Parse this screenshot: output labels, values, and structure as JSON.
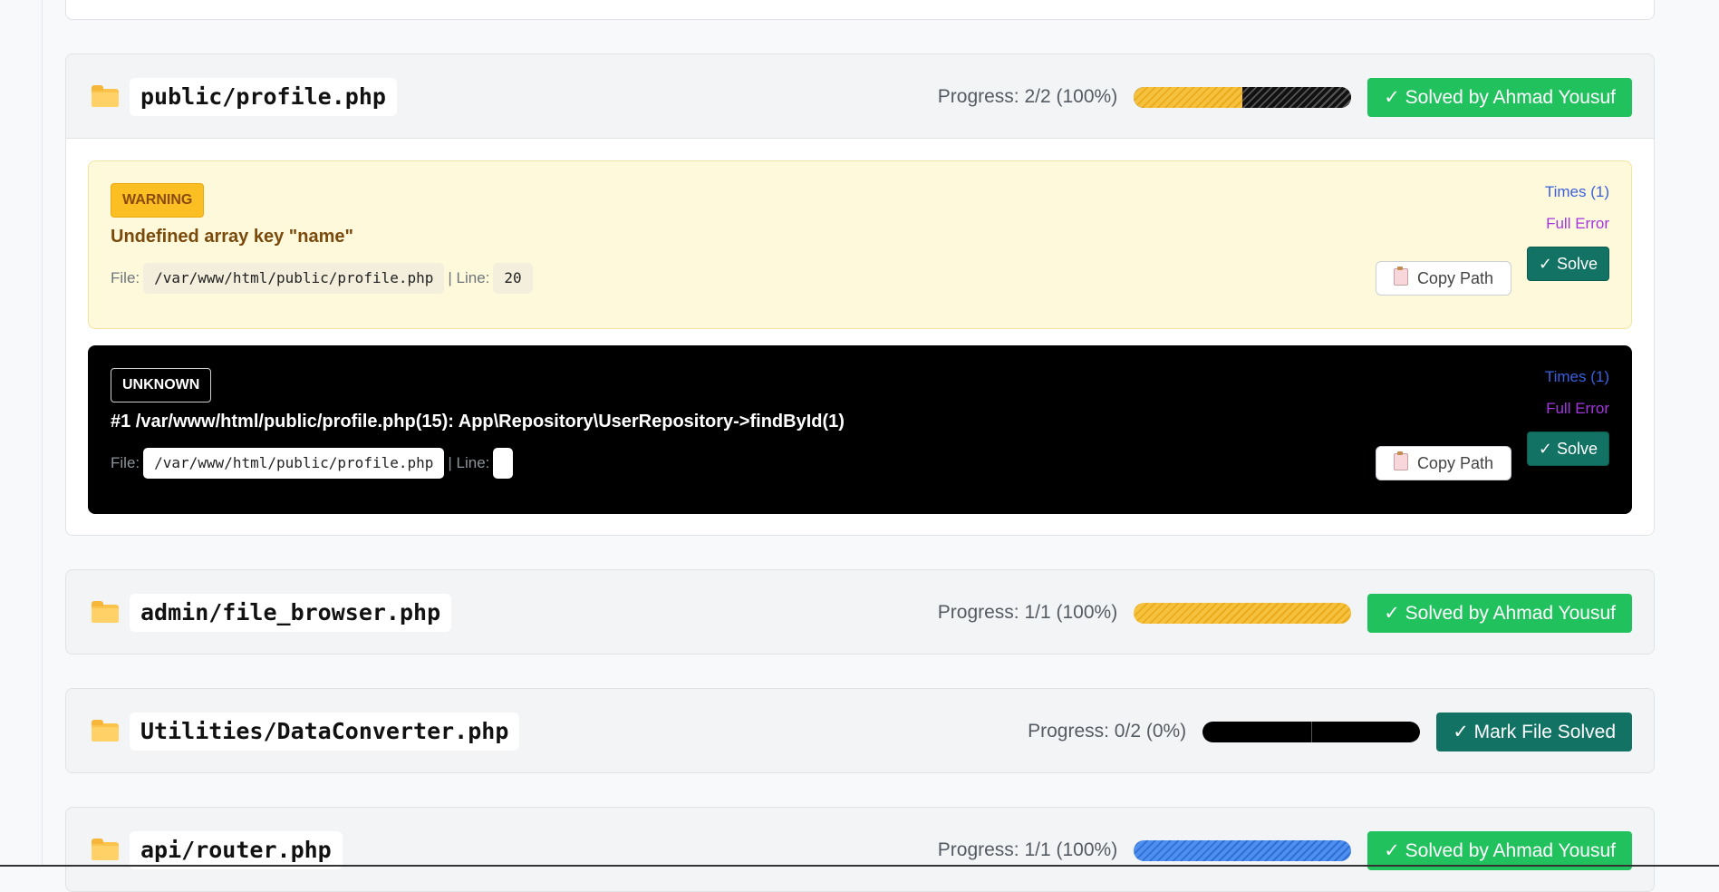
{
  "files": [
    {
      "name": "public/profile.php",
      "progress_text": "Progress: 2/2 (100%)",
      "progress_fraction": 0.5,
      "status_label": "✓ Solved by Ahmad Yousuf",
      "issues": [
        {
          "badge": "WARNING",
          "message": "Undefined array key \"name\"",
          "file_label": "File:",
          "path": "/var/www/html/public/profile.php",
          "line_label": "| Line:",
          "line": "20",
          "times": "Times (1)",
          "full_error": "Full Error",
          "solve": "✓ Solve",
          "copy": "Copy Path"
        },
        {
          "badge": "UNKNOWN",
          "message": "#1 /var/www/html/public/profile.php(15): App\\Repository\\UserRepository->findById(1)",
          "file_label": "File:",
          "path": "/var/www/html/public/profile.php",
          "line_label": "| Line:",
          "line": "",
          "times": "Times (1)",
          "full_error": "Full Error",
          "solve": "✓ Solve",
          "copy": "Copy Path"
        }
      ]
    },
    {
      "name": "admin/file_browser.php",
      "progress_text": "Progress: 1/1 (100%)",
      "progress_fraction": 1.0,
      "status_label": "✓ Solved by Ahmad Yousuf"
    },
    {
      "name": "Utilities/DataConverter.php",
      "progress_text": "Progress: 0/2 (0%)",
      "progress_fraction": 0.0,
      "status_label": "✓ Mark File Solved"
    },
    {
      "name": "api/router.php",
      "progress_text": "Progress: 1/1 (100%)",
      "progress_fraction": 1.0,
      "status_label": "✓ Solved by Ahmad Yousuf"
    }
  ],
  "colors": {
    "solved": "#21c25e",
    "mark_solved": "#127264",
    "warning_badge": "#fbbf24",
    "progress_yellow": "#f6c23e",
    "progress_blue": "#4f8ff0"
  },
  "icons": [
    "folder-icon",
    "clipboard-icon"
  ]
}
